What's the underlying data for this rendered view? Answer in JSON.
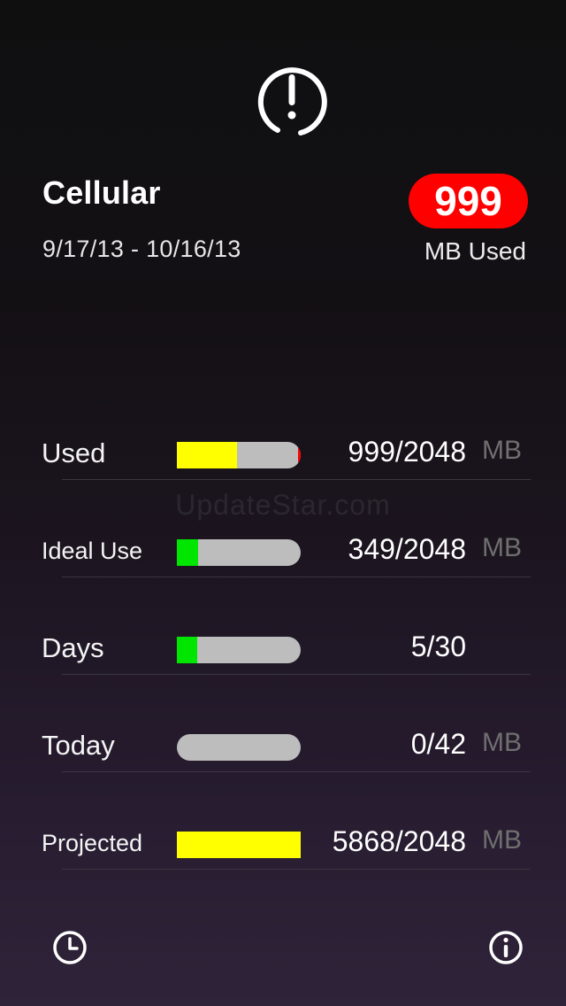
{
  "header": {
    "icon": "alert-circle-icon",
    "title": "Cellular",
    "date_range": "9/17/13 - 10/16/13"
  },
  "usage_badge": {
    "value": "999",
    "caption": "MB Used",
    "color": "#ff0000"
  },
  "watermark": "UpdateStar.com",
  "rows": [
    {
      "label": "Used",
      "value": "999/2048",
      "unit": "MB",
      "progress": 0.4878,
      "fill_color": "#ffff00",
      "over_limit_marker": true
    },
    {
      "label": "Ideal Use",
      "value": "349/2048",
      "unit": "MB",
      "progress": 0.1704,
      "fill_color": "#00e600"
    },
    {
      "label": "Days",
      "value": "5/30",
      "unit": "",
      "progress": 0.1667,
      "fill_color": "#00e600"
    },
    {
      "label": "Today",
      "value": "0/42",
      "unit": "MB",
      "progress": 0.0,
      "fill_color": "#00e600"
    },
    {
      "label": "Projected",
      "value": "5868/2048",
      "unit": "MB",
      "progress": 1.0,
      "fill_color": "#ffff00"
    }
  ],
  "footer": {
    "history_icon": "clock-icon",
    "info_icon": "info-icon"
  },
  "colors": {
    "track": "#bdbdbd",
    "unit_text": "#6f6f6f"
  }
}
